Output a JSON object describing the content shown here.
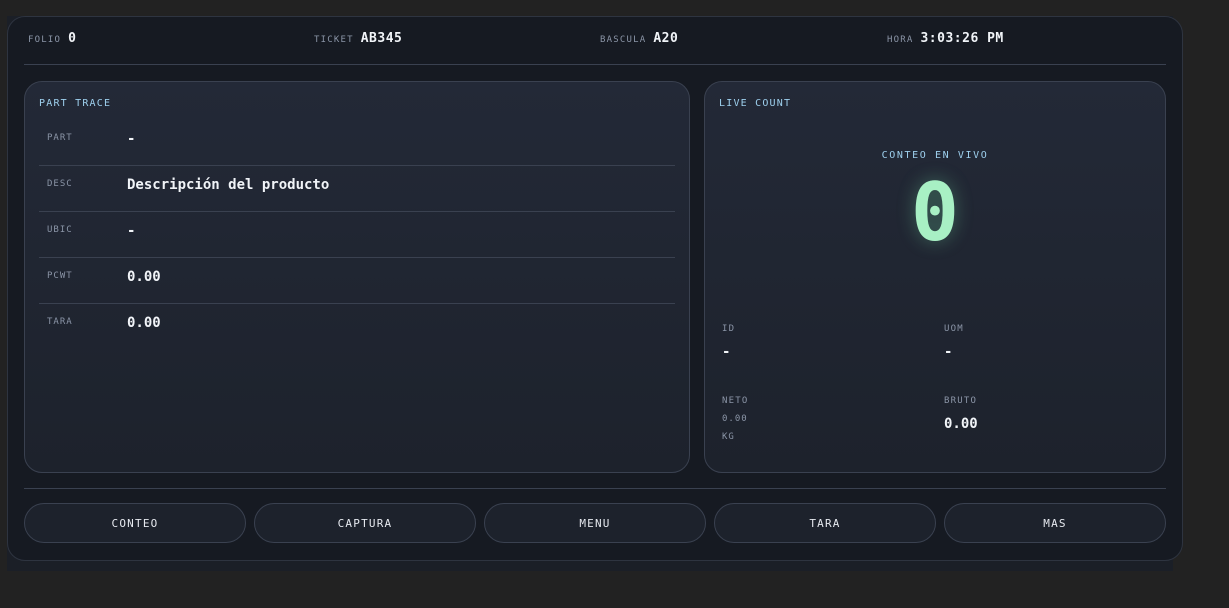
{
  "header": {
    "folio": {
      "label": "FOLIO",
      "value": "0"
    },
    "ticket": {
      "label": "TICKET",
      "value": "AB345"
    },
    "bascula": {
      "label": "BASCULA",
      "value": "A20"
    },
    "hora": {
      "label": "HORA",
      "value": "3:03:26 PM"
    }
  },
  "part_trace": {
    "title": "PART TRACE",
    "rows": [
      {
        "key": "PART",
        "value": "-"
      },
      {
        "key": "DESC",
        "value": "Descripción del producto"
      },
      {
        "key": "UBIC",
        "value": "-"
      },
      {
        "key": "PCWT",
        "value": "0.00"
      },
      {
        "key": "TARA",
        "value": "0.00"
      }
    ]
  },
  "live_count": {
    "title": "LIVE COUNT",
    "caption": "CONTEO EN VIVO",
    "value": "0",
    "id": {
      "label": "ID",
      "value": "-"
    },
    "uom": {
      "label": "UOM",
      "value": "-"
    },
    "neto": {
      "label": "NETO",
      "value": "0.00",
      "unit": "KG"
    },
    "bruto": {
      "label": "BRUTO",
      "value": "0.00"
    }
  },
  "actions": [
    "CONTEO",
    "CAPTURA",
    "MENU",
    "TARA",
    "MAS"
  ],
  "colors": {
    "background": "#222222",
    "panel": "#1d222c",
    "accent": "#9ed0ee",
    "live_value": "#a8f0c4",
    "border": "#3a4150"
  }
}
